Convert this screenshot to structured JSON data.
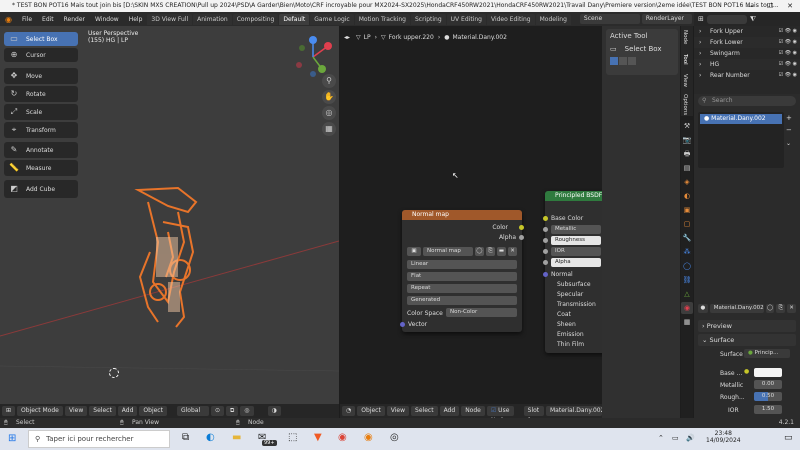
{
  "window": {
    "title": "* TEST BON POT16 Mais tout join bis [D:\\SKIN MXS CREATION\\Pull up 2024\\PSD\\A Garder\\Bien\\Moto\\CRF incroyable pour MX2024-SX2025\\HondaCRF450RW2021\\HondaCRF450RW2021\\Travail Dany\\Premiere version\\2eme idée\\TEST BON POT16 Mais tout..."
  },
  "menus": [
    "File",
    "Edit",
    "Render",
    "Window",
    "Help"
  ],
  "workspaces": [
    "3D View Full",
    "Animation",
    "Compositing",
    "Default",
    "Game Logic",
    "Motion Tracking",
    "Scripting",
    "UV Editing",
    "Video Editing",
    "Modeling"
  ],
  "active_workspace": "Default",
  "scene": "Scene",
  "view_layer": "RenderLayer",
  "viewport": {
    "info1": "User Perspective",
    "info2": "(155) HG | LP",
    "tools": [
      {
        "label": "Select Box",
        "icon": "select-box-icon",
        "active": true
      },
      {
        "label": "Cursor",
        "icon": "cursor-icon"
      },
      {
        "label": "Move",
        "icon": "move-icon"
      },
      {
        "label": "Rotate",
        "icon": "rotate-icon"
      },
      {
        "label": "Scale",
        "icon": "scale-icon"
      },
      {
        "label": "Transform",
        "icon": "transform-icon"
      },
      {
        "label": "Annotate",
        "icon": "annotate-icon"
      },
      {
        "label": "Measure",
        "icon": "measure-icon"
      },
      {
        "label": "Add Cube",
        "icon": "add-cube-icon"
      }
    ],
    "header": {
      "mode": "Object Mode",
      "view": "View",
      "select": "Select",
      "add": "Add",
      "object": "Object",
      "orientation": "Global"
    }
  },
  "node_editor": {
    "breadcrumb": [
      "LP",
      "Fork upper.220",
      "Material.Dany.002"
    ],
    "header": {
      "type": "Object",
      "view": "View",
      "select": "Select",
      "add": "Add",
      "node": "Node",
      "use_nodes": "Use Nodes",
      "slot": "Slot 1",
      "material": "Material.Dany.002"
    },
    "normal_map": {
      "title": "Normal map",
      "out_color": "Color",
      "out_alpha": "Alpha",
      "image": "Normal map",
      "interp": "Linear",
      "proj": "Flat",
      "ext": "Repeat",
      "source": "Generated",
      "color_space_label": "Color Space",
      "color_space": "Non-Color",
      "vector": "Vector"
    },
    "principled": {
      "title": "Principled BSDF",
      "inputs": [
        "Base Color",
        "Metallic",
        "Roughness",
        "IOR",
        "Alpha",
        "Normal",
        "Subsurface",
        "Specular",
        "Transmission",
        "Coat",
        "Sheen",
        "Emission",
        "Thin Film"
      ]
    }
  },
  "sidepanel": {
    "title": "Active Tool",
    "tool": "Select Box",
    "tabs": [
      "Node",
      "Tool",
      "View",
      "Options"
    ]
  },
  "outliner": {
    "items": [
      "Fork Upper",
      "Fork Lower",
      "Swingarm",
      "HG",
      "Rear Number"
    ]
  },
  "properties": {
    "search": "Search",
    "material": "Material.Dany.002",
    "preview": "Preview",
    "surface": "Surface",
    "surface_label": "Surface",
    "surface_value": "Princip...",
    "base_label": "Base ...",
    "metallic_label": "Metallic",
    "metallic_value": "0.00",
    "rough_label": "Rough...",
    "rough_value": "0.50",
    "ior_label": "IOR",
    "ior_value": "1.50"
  },
  "status": {
    "select": "Select",
    "pan": "Pan View",
    "node": "Node",
    "version": "4.2.1"
  },
  "taskbar": {
    "search": "Taper ici pour rechercher",
    "time": "23:48",
    "date": "14/09/2024",
    "badge": "99+"
  },
  "colors": {
    "accent": "#4772b3",
    "nm_header": "#a0582a",
    "bsdf_header": "#2f7a3e",
    "orange": "#e8742a"
  }
}
